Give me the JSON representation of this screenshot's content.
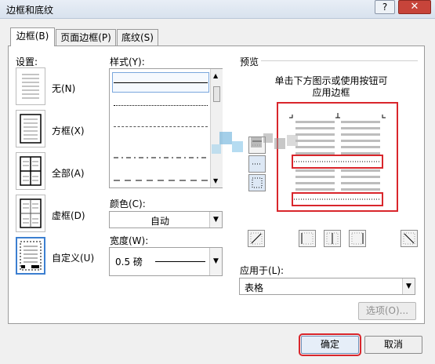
{
  "window": {
    "title": "边框和底纹",
    "help": "?",
    "close": "✕"
  },
  "tabs": [
    {
      "label": "边框(B)"
    },
    {
      "label": "页面边框(P)"
    },
    {
      "label": "底纹(S)"
    }
  ],
  "settings": {
    "label": "设置:",
    "items": [
      {
        "label": "无(N)",
        "icon": "border-none-icon"
      },
      {
        "label": "方框(X)",
        "icon": "border-box-icon"
      },
      {
        "label": "全部(A)",
        "icon": "border-all-icon"
      },
      {
        "label": "虚框(D)",
        "icon": "border-grid-icon"
      },
      {
        "label": "自定义(U)",
        "icon": "border-custom-icon",
        "selected": true
      }
    ]
  },
  "style": {
    "label": "样式(Y):",
    "options": [
      "solid",
      "dotted",
      "dashed",
      "dash-dot",
      "long-dash"
    ],
    "selected": "solid"
  },
  "color": {
    "label": "颜色(C):",
    "value": "自动"
  },
  "width": {
    "label": "宽度(W):",
    "value": "0.5 磅"
  },
  "preview": {
    "label": "预览",
    "hint_line1": "单击下方图示或使用按钮可",
    "hint_line2": "应用边框",
    "highlight_color": "#d9262c"
  },
  "apply_to": {
    "label": "应用于(L):",
    "value": "表格"
  },
  "buttons": {
    "options": "选项(O)...",
    "ok": "确定",
    "cancel": "取消"
  }
}
